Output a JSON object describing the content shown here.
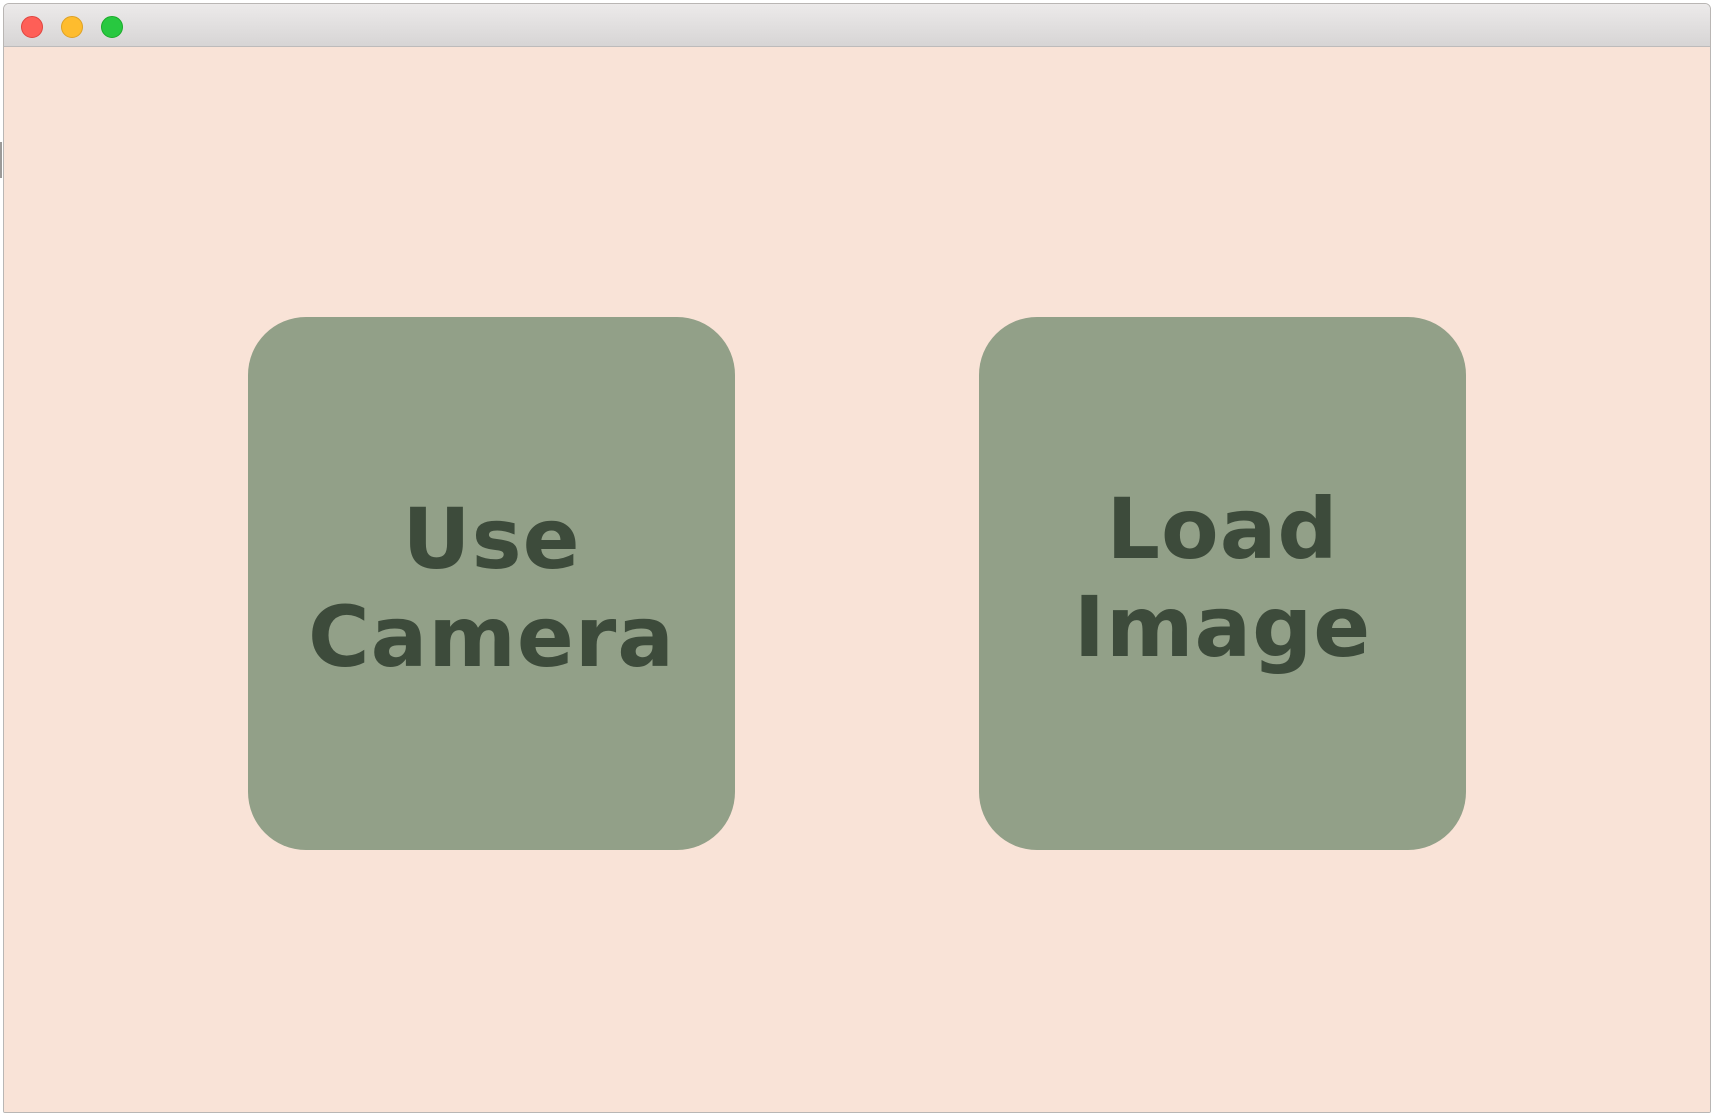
{
  "window": {
    "controls": [
      "close-button",
      "minimize-button",
      "zoom-button"
    ]
  },
  "main": {
    "tiles": [
      {
        "label_line1": "Use",
        "label_line2": "Camera"
      },
      {
        "label_line1": "Load",
        "label_line2": "Image"
      }
    ]
  },
  "colors": {
    "background": "#f9e3d7",
    "tile": "#92a088",
    "tile_text": "#3d4b3b"
  }
}
